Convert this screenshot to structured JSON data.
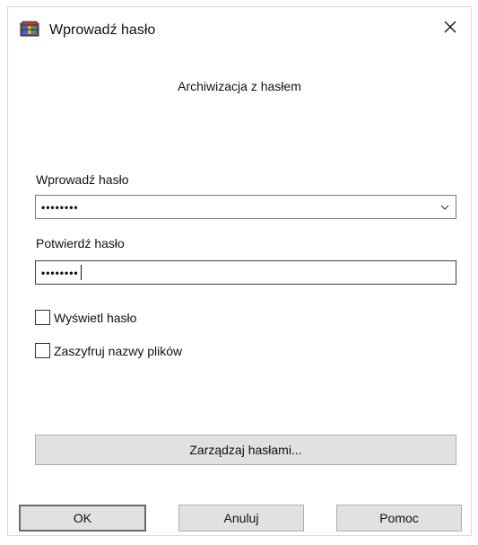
{
  "window": {
    "title": "Wprowadź hasło",
    "subtitle": "Archiwizacja z hasłem"
  },
  "password": {
    "label": "Wprowadź hasło",
    "masked_value": "••••••••"
  },
  "confirm": {
    "label": "Potwierdź hasło",
    "masked_value": "••••••••"
  },
  "options": {
    "show_password": {
      "label": "Wyświetl hasło",
      "checked": false
    },
    "encrypt_names": {
      "label": "Zaszyfruj nazwy plików",
      "checked": false
    }
  },
  "buttons": {
    "manage": "Zarządzaj hasłami...",
    "ok": "OK",
    "cancel": "Anuluj",
    "help": "Pomoc"
  },
  "icons": {
    "app": "winrar-archive-icon",
    "close": "close-icon",
    "dropdown": "chevron-down-icon"
  }
}
